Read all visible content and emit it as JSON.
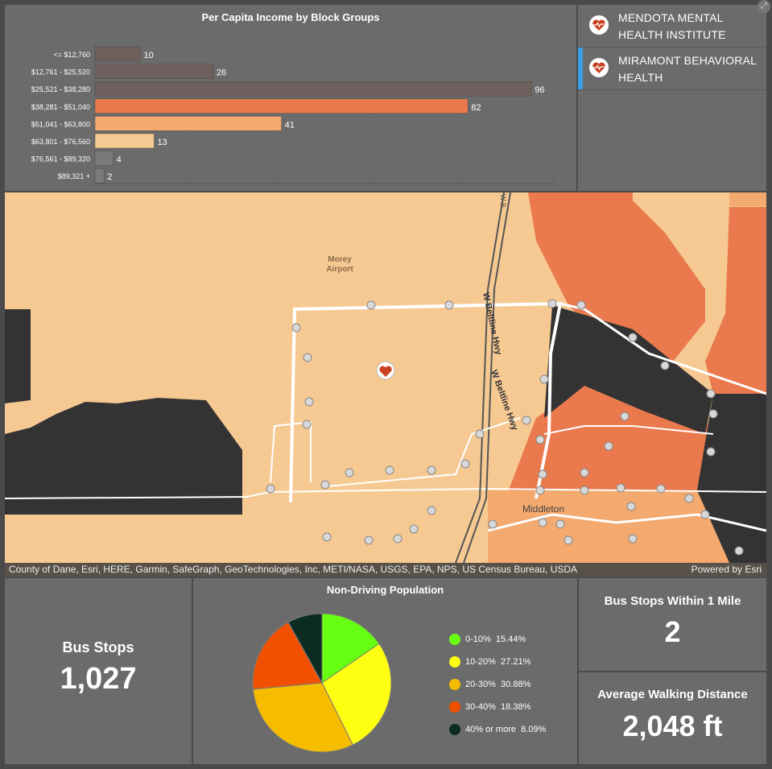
{
  "bar_chart": {
    "title": "Per Capita Income by Block Groups",
    "chart_data": {
      "type": "bar",
      "orientation": "horizontal",
      "title": "Per Capita Income by Block Groups",
      "categories": [
        "<= $12,760",
        "$12,761 - $25,520",
        "$25,521 - $38,280",
        "$38,281 - $51,040",
        "$51,041 - $63,800",
        "$63,801 - $76,560",
        "$76,561 - $89,320",
        "$89,321 +"
      ],
      "values": [
        10,
        26,
        96,
        82,
        41,
        13,
        4,
        2
      ],
      "colors": [
        "#6e5f5c",
        "#6e5f5c",
        "#6e5f5c",
        "#ea7a4e",
        "#f4a96e",
        "#f7c992",
        "#7a7a7a",
        "#7a7a7a"
      ],
      "xlim": [
        0,
        100
      ],
      "grid": true
    }
  },
  "facilities": {
    "items": [
      {
        "label_line1": "MENDOTA MENTAL",
        "label_line2": "HEALTH INSTITUTE",
        "icon": "heart-pulse-icon",
        "selected": false
      },
      {
        "label_line1": "MIRAMONT BEHAVIORAL",
        "label_line2": "HEALTH",
        "icon": "heart-pulse-icon",
        "selected": true
      }
    ]
  },
  "map": {
    "labels": {
      "airport_line1": "Morey",
      "airport_line2": "Airport",
      "highway1": "W Beltline Hwy",
      "highway2": "W Beltline Hwy",
      "city": "Middleton",
      "top_road": "W B"
    },
    "attribution": "County of Dane, Esri, HERE, Garmin, SafeGraph, GeoTechnologies, Inc, METI/NASA, USGS, EPA, NPS, US Census Bureau, USDA",
    "powered_by": "Powered by Esri",
    "colors": {
      "light": "#f7c992",
      "medium": "#f4a96e",
      "dark": "#ea7a4e",
      "nodata": "#333333",
      "roads": "#ffffff"
    }
  },
  "bus_stops": {
    "title": "Bus Stops",
    "value": "1,027"
  },
  "pie": {
    "title": "Non-Driving Population",
    "chart_data": {
      "type": "pie",
      "title": "Non-Driving Population",
      "slices": [
        {
          "label": "0-10%",
          "value": 15.44,
          "display": "15.44%",
          "color": "#66ff11"
        },
        {
          "label": "10-20%",
          "value": 27.21,
          "display": "27.21%",
          "color": "#ffff11"
        },
        {
          "label": "20-30%",
          "value": 30.88,
          "display": "30.88%",
          "color": "#f5bc00"
        },
        {
          "label": "30-40%",
          "value": 18.38,
          "display": "18.38%",
          "color": "#f05000"
        },
        {
          "label": "40% or more",
          "value": 8.09,
          "display": "8.09%",
          "color": "#0c2b21"
        }
      ],
      "legend": "right"
    }
  },
  "within_mile": {
    "title": "Bus Stops Within 1 Mile",
    "value": "2"
  },
  "walking": {
    "title": "Average Walking Distance",
    "value": "2,048 ft"
  }
}
